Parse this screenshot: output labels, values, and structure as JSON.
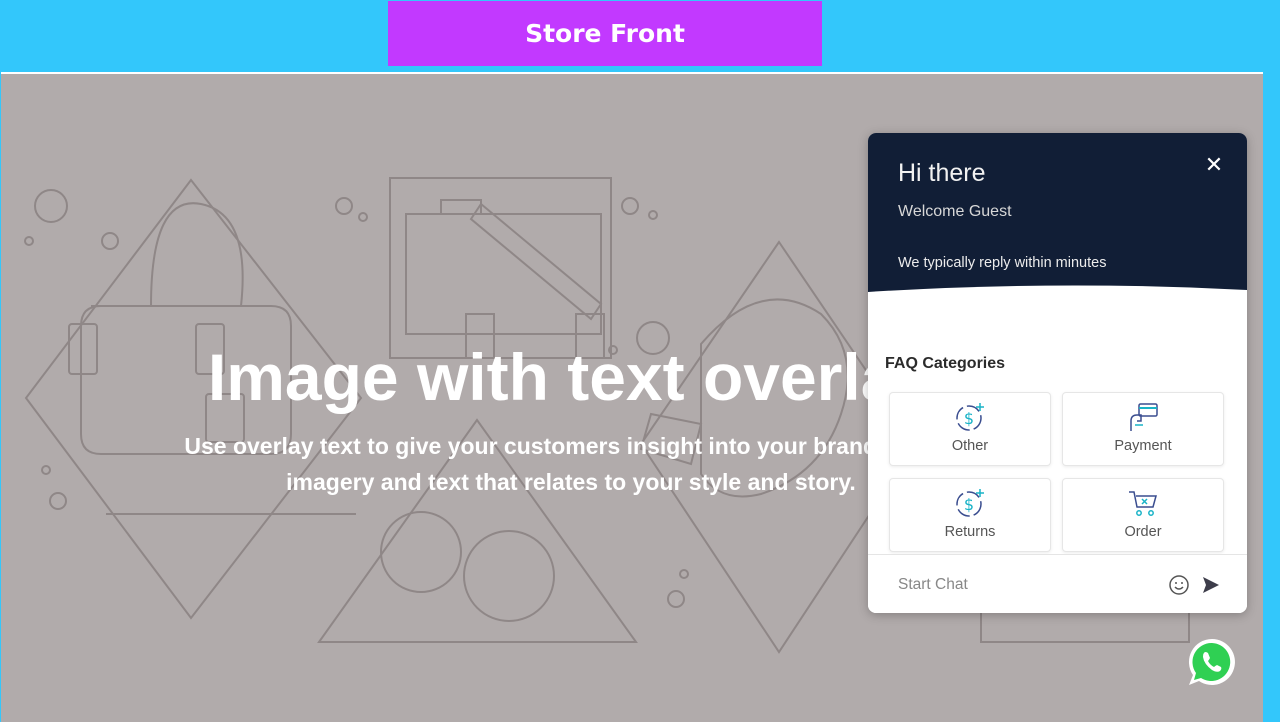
{
  "banner": {
    "title": "Store Front"
  },
  "hero": {
    "title": "Image with text overlay",
    "subtitle_line1": "Use overlay text to give your customers insight into your brand. Select",
    "subtitle_line2": "imagery and text that relates to your style and story."
  },
  "chat": {
    "greeting": "Hi there",
    "welcome": "Welcome Guest",
    "reply_time": "We typically reply within minutes",
    "faq_title": "FAQ Categories",
    "categories": [
      {
        "label": "Other",
        "icon": "dollar-refresh-icon"
      },
      {
        "label": "Payment",
        "icon": "card-payment-icon"
      },
      {
        "label": "Returns",
        "icon": "dollar-refresh-icon"
      },
      {
        "label": "Order",
        "icon": "cart-icon"
      }
    ],
    "input_placeholder": "Start Chat",
    "input_value": ""
  },
  "colors": {
    "page_bg": "#33c7fb",
    "banner_bg": "#c239ff",
    "hero_bg": "#b1abab",
    "chat_header_bg": "#111e36",
    "whatsapp": "#2fd053"
  }
}
